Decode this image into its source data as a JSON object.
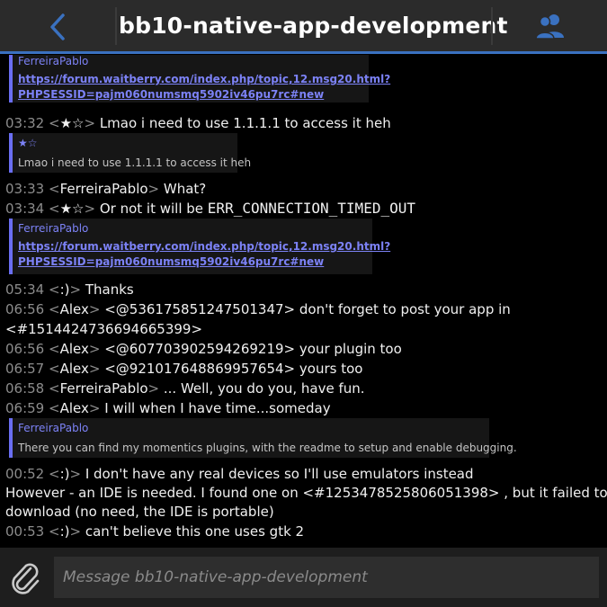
{
  "header": {
    "title": "bb10-native-app-development",
    "back_icon": "chevron-left-icon",
    "members_icon": "members-icon",
    "accent": "#3a71c0"
  },
  "messages": [
    {
      "type": "quote",
      "author": "FerreiraPablo",
      "link_lines": [
        "https://forum.waitberry.com/index.php/topic,12.msg20.html?",
        "PHPSESSID=pajm060numsmq5902iv46pu7rc#new"
      ]
    },
    {
      "type": "msg",
      "time": "03:32",
      "nick": "★☆",
      "text": "Lmao i need to use 1.1.1.1 to access it heh"
    },
    {
      "type": "quote",
      "author": "★☆",
      "text": "Lmao i need to use 1.1.1.1 to access it heh"
    },
    {
      "type": "msg",
      "time": "03:33",
      "nick": "FerreiraPablo",
      "text": "What?"
    },
    {
      "type": "msg",
      "time": "03:34",
      "nick": "★☆",
      "text": "Or not it will be",
      "code": "ERR_CONNECTION_TIMED_OUT"
    },
    {
      "type": "quote",
      "author": "FerreiraPablo",
      "link_lines": [
        "https://forum.waitberry.com/index.php/topic,12.msg20.html?",
        "PHPSESSID=pajm060numsmq5902iv46pu7rc#new"
      ]
    },
    {
      "type": "msg",
      "time": "05:34",
      "nick": ":)",
      "text": "Thanks"
    },
    {
      "type": "msg",
      "time": "06:56",
      "nick": "Alex",
      "text": "<@536175851247501347> don't forget to post your app in",
      "cont": "<#1514424736694665399>"
    },
    {
      "type": "msg",
      "time": "06:56",
      "nick": "Alex",
      "text": "<@607703902594269219> your plugin too"
    },
    {
      "type": "msg",
      "time": "06:57",
      "nick": "Alex",
      "text": "<@921017648869957654> yours too"
    },
    {
      "type": "msg",
      "time": "06:58",
      "nick": "FerreiraPablo",
      "text": "... Well, you do you, have fun."
    },
    {
      "type": "msg",
      "time": "06:59",
      "nick": "Alex",
      "text": "I will when I have time...someday"
    },
    {
      "type": "quote",
      "author": "FerreiraPablo",
      "text": "There you can find my momentics plugins, with the readme to setup and enable debugging."
    },
    {
      "type": "msg",
      "time": "00:52",
      "nick": ":)",
      "text": "I don't have any real devices so I'll use emulators instead"
    },
    {
      "type": "plain",
      "lines": [
        "However - an IDE is needed. I found one on <#1253478525806051398> , but it failed to",
        "download (no need, the IDE is portable)"
      ]
    },
    {
      "type": "msg",
      "time": "00:53",
      "nick": ":)",
      "text": "can't believe this one uses gtk 2"
    }
  ],
  "composer": {
    "placeholder": "Message bb10-native-app-development",
    "attach_icon": "paperclip-icon"
  }
}
